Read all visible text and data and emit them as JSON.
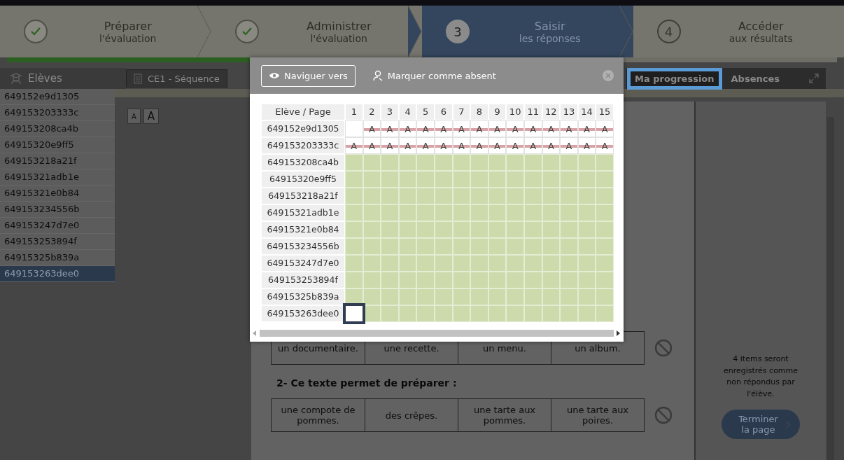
{
  "stepper": {
    "steps": [
      {
        "title": "Préparer",
        "subtitle": "l'évaluation",
        "kind": "done",
        "selected": false
      },
      {
        "title": "Administrer",
        "subtitle": "l'évaluation",
        "kind": "done",
        "selected": false
      },
      {
        "title": "Saisir",
        "subtitle": "les réponses",
        "kind": "numbered",
        "number": "3",
        "selected": true
      },
      {
        "title": "Accéder",
        "subtitle": "aux résultats",
        "kind": "numbered",
        "number": "4",
        "selected": false
      }
    ],
    "progress": {
      "level": 0.67
    }
  },
  "sidebar": {
    "title": "Elèves",
    "items": [
      {
        "label": "649152e9d1305",
        "selected": false
      },
      {
        "label": "649153203333c",
        "selected": false
      },
      {
        "label": "649153208ca4b",
        "selected": false
      },
      {
        "label": "64915320e9ff5",
        "selected": false
      },
      {
        "label": "649153218a21f",
        "selected": false
      },
      {
        "label": "64915321adb1e",
        "selected": false
      },
      {
        "label": "64915321e0b84",
        "selected": false
      },
      {
        "label": "649153234556b",
        "selected": false
      },
      {
        "label": "649153247d7e0",
        "selected": false
      },
      {
        "label": "649153253894f",
        "selected": false
      },
      {
        "label": "64915325b839a",
        "selected": false
      },
      {
        "label": "649153263dee0",
        "selected": true
      }
    ]
  },
  "document_tab": {
    "label": "CE1 - Séquence"
  },
  "right_tabs": [
    {
      "label": "Ma progression",
      "highlighted": true
    },
    {
      "label": "Absences",
      "highlighted": false
    }
  ],
  "font_buttons": [
    {
      "label": "A",
      "kind": "small"
    },
    {
      "label": "A",
      "kind": "large"
    }
  ],
  "questions": [
    {
      "answers": [
        "un documentaire.",
        "une recette.",
        "un menu.",
        "un album."
      ]
    },
    {
      "title": "2- Ce texte permet de préparer :",
      "answers": [
        "une compote de pommes.",
        "des crêpes.",
        "une tarte aux pommes.",
        "une tarte aux poires."
      ]
    }
  ],
  "finish_panel": {
    "message": "4 items seront enregistrés comme non répondus par l'élève.",
    "button": "Terminer la page"
  },
  "popup": {
    "buttons": [
      {
        "label": "Naviguer vers",
        "kind": "outlined"
      },
      {
        "label": "Marquer comme absent",
        "kind": "plain"
      }
    ],
    "grid": {
      "corner": "Elève / Page",
      "columns": [
        "1",
        "2",
        "3",
        "4",
        "5",
        "6",
        "7",
        "8",
        "9",
        "10",
        "11",
        "12",
        "13",
        "14",
        "15"
      ],
      "rows": [
        {
          "label": "649152e9d1305",
          "cells": [
            {
              "kind": "empty"
            },
            {
              "kind": "absent",
              "text": "A"
            },
            {
              "kind": "absent",
              "text": "A"
            },
            {
              "kind": "absent",
              "text": "A"
            },
            {
              "kind": "absent",
              "text": "A"
            },
            {
              "kind": "absent",
              "text": "A"
            },
            {
              "kind": "absent",
              "text": "A"
            },
            {
              "kind": "absent",
              "text": "A"
            },
            {
              "kind": "absent",
              "text": "A"
            },
            {
              "kind": "absent",
              "text": "A"
            },
            {
              "kind": "absent",
              "text": "A"
            },
            {
              "kind": "absent",
              "text": "A"
            },
            {
              "kind": "absent",
              "text": "A"
            },
            {
              "kind": "absent",
              "text": "A"
            },
            {
              "kind": "absent",
              "text": "A"
            }
          ]
        },
        {
          "label": "649153203333c",
          "cells": [
            {
              "kind": "absent",
              "text": "A"
            },
            {
              "kind": "absent",
              "text": "A"
            },
            {
              "kind": "absent",
              "text": "A"
            },
            {
              "kind": "absent",
              "text": "A"
            },
            {
              "kind": "absent",
              "text": "A"
            },
            {
              "kind": "absent",
              "text": "A"
            },
            {
              "kind": "absent",
              "text": "A"
            },
            {
              "kind": "absent",
              "text": "A"
            },
            {
              "kind": "absent",
              "text": "A"
            },
            {
              "kind": "absent",
              "text": "A"
            },
            {
              "kind": "absent",
              "text": "A"
            },
            {
              "kind": "absent",
              "text": "A"
            },
            {
              "kind": "absent",
              "text": "A"
            },
            {
              "kind": "absent",
              "text": "A"
            },
            {
              "kind": "absent",
              "text": "A"
            }
          ]
        },
        {
          "label": "649153208ca4b",
          "cells": [
            {
              "kind": "done"
            },
            {
              "kind": "done"
            },
            {
              "kind": "done"
            },
            {
              "kind": "done"
            },
            {
              "kind": "done"
            },
            {
              "kind": "done"
            },
            {
              "kind": "done"
            },
            {
              "kind": "done"
            },
            {
              "kind": "done"
            },
            {
              "kind": "done"
            },
            {
              "kind": "done"
            },
            {
              "kind": "done"
            },
            {
              "kind": "done"
            },
            {
              "kind": "done"
            },
            {
              "kind": "done"
            }
          ]
        },
        {
          "label": "64915320e9ff5",
          "cells": [
            {
              "kind": "done"
            },
            {
              "kind": "done"
            },
            {
              "kind": "done"
            },
            {
              "kind": "done"
            },
            {
              "kind": "done"
            },
            {
              "kind": "done"
            },
            {
              "kind": "done"
            },
            {
              "kind": "done"
            },
            {
              "kind": "done"
            },
            {
              "kind": "done"
            },
            {
              "kind": "done"
            },
            {
              "kind": "done"
            },
            {
              "kind": "done"
            },
            {
              "kind": "done"
            },
            {
              "kind": "done"
            }
          ]
        },
        {
          "label": "649153218a21f",
          "cells": [
            {
              "kind": "done"
            },
            {
              "kind": "done"
            },
            {
              "kind": "done"
            },
            {
              "kind": "done"
            },
            {
              "kind": "done"
            },
            {
              "kind": "done"
            },
            {
              "kind": "done"
            },
            {
              "kind": "done"
            },
            {
              "kind": "done"
            },
            {
              "kind": "done"
            },
            {
              "kind": "done"
            },
            {
              "kind": "done"
            },
            {
              "kind": "done"
            },
            {
              "kind": "done"
            },
            {
              "kind": "done"
            }
          ]
        },
        {
          "label": "64915321adb1e",
          "cells": [
            {
              "kind": "done"
            },
            {
              "kind": "done"
            },
            {
              "kind": "done"
            },
            {
              "kind": "done"
            },
            {
              "kind": "done"
            },
            {
              "kind": "done"
            },
            {
              "kind": "done"
            },
            {
              "kind": "done"
            },
            {
              "kind": "done"
            },
            {
              "kind": "done"
            },
            {
              "kind": "done"
            },
            {
              "kind": "done"
            },
            {
              "kind": "done"
            },
            {
              "kind": "done"
            },
            {
              "kind": "done"
            }
          ]
        },
        {
          "label": "64915321e0b84",
          "cells": [
            {
              "kind": "done"
            },
            {
              "kind": "done"
            },
            {
              "kind": "done"
            },
            {
              "kind": "done"
            },
            {
              "kind": "done"
            },
            {
              "kind": "done"
            },
            {
              "kind": "done"
            },
            {
              "kind": "done"
            },
            {
              "kind": "done"
            },
            {
              "kind": "done"
            },
            {
              "kind": "done"
            },
            {
              "kind": "done"
            },
            {
              "kind": "done"
            },
            {
              "kind": "done"
            },
            {
              "kind": "done"
            }
          ]
        },
        {
          "label": "649153234556b",
          "cells": [
            {
              "kind": "done"
            },
            {
              "kind": "done"
            },
            {
              "kind": "done"
            },
            {
              "kind": "done"
            },
            {
              "kind": "done"
            },
            {
              "kind": "done"
            },
            {
              "kind": "done"
            },
            {
              "kind": "done"
            },
            {
              "kind": "done"
            },
            {
              "kind": "done"
            },
            {
              "kind": "done"
            },
            {
              "kind": "done"
            },
            {
              "kind": "done"
            },
            {
              "kind": "done"
            },
            {
              "kind": "done"
            }
          ]
        },
        {
          "label": "649153247d7e0",
          "cells": [
            {
              "kind": "done"
            },
            {
              "kind": "done"
            },
            {
              "kind": "done"
            },
            {
              "kind": "done"
            },
            {
              "kind": "done"
            },
            {
              "kind": "done"
            },
            {
              "kind": "done"
            },
            {
              "kind": "done"
            },
            {
              "kind": "done"
            },
            {
              "kind": "done"
            },
            {
              "kind": "done"
            },
            {
              "kind": "done"
            },
            {
              "kind": "done"
            },
            {
              "kind": "done"
            },
            {
              "kind": "done"
            }
          ]
        },
        {
          "label": "649153253894f",
          "cells": [
            {
              "kind": "done"
            },
            {
              "kind": "done"
            },
            {
              "kind": "done"
            },
            {
              "kind": "done"
            },
            {
              "kind": "done"
            },
            {
              "kind": "done"
            },
            {
              "kind": "done"
            },
            {
              "kind": "done"
            },
            {
              "kind": "done"
            },
            {
              "kind": "done"
            },
            {
              "kind": "done"
            },
            {
              "kind": "done"
            },
            {
              "kind": "done"
            },
            {
              "kind": "done"
            },
            {
              "kind": "done"
            }
          ]
        },
        {
          "label": "64915325b839a",
          "cells": [
            {
              "kind": "done"
            },
            {
              "kind": "done"
            },
            {
              "kind": "done"
            },
            {
              "kind": "done"
            },
            {
              "kind": "done"
            },
            {
              "kind": "done"
            },
            {
              "kind": "done"
            },
            {
              "kind": "done"
            },
            {
              "kind": "done"
            },
            {
              "kind": "done"
            },
            {
              "kind": "done"
            },
            {
              "kind": "done"
            },
            {
              "kind": "done"
            },
            {
              "kind": "done"
            },
            {
              "kind": "done"
            }
          ]
        },
        {
          "label": "649153263dee0",
          "cells": [
            {
              "kind": "current"
            },
            {
              "kind": "done"
            },
            {
              "kind": "done"
            },
            {
              "kind": "done"
            },
            {
              "kind": "done"
            },
            {
              "kind": "done"
            },
            {
              "kind": "done"
            },
            {
              "kind": "done"
            },
            {
              "kind": "done"
            },
            {
              "kind": "done"
            },
            {
              "kind": "done"
            },
            {
              "kind": "done"
            },
            {
              "kind": "done"
            },
            {
              "kind": "done"
            },
            {
              "kind": "done"
            }
          ]
        }
      ]
    }
  }
}
